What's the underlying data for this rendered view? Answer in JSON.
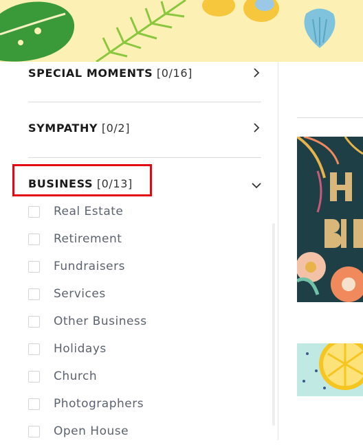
{
  "categories": [
    {
      "name": "SPECIAL MOMENTS",
      "count": "[0/16]",
      "state": "collapsed"
    },
    {
      "name": "SYMPATHY",
      "count": "[0/2]",
      "state": "collapsed"
    },
    {
      "name": "BUSINESS",
      "count": "[0/13]",
      "state": "expanded"
    }
  ],
  "business_subcategories": [
    {
      "label": "Real Estate",
      "checked": false
    },
    {
      "label": "Retirement",
      "checked": false
    },
    {
      "label": "Fundraisers",
      "checked": false
    },
    {
      "label": "Services",
      "checked": false
    },
    {
      "label": "Other Business",
      "checked": false
    },
    {
      "label": "Holidays",
      "checked": false
    },
    {
      "label": "Church",
      "checked": false
    },
    {
      "label": "Photographers",
      "checked": false
    },
    {
      "label": "Open House",
      "checked": false
    }
  ],
  "icons": {
    "collapsed": "chevron-right-icon",
    "expanded": "chevron-down-icon"
  },
  "colors": {
    "banner": "#fdf0b4",
    "highlight": "#e30613",
    "card_dark": "#1f3f47",
    "card_light": "#bfe9e2"
  }
}
